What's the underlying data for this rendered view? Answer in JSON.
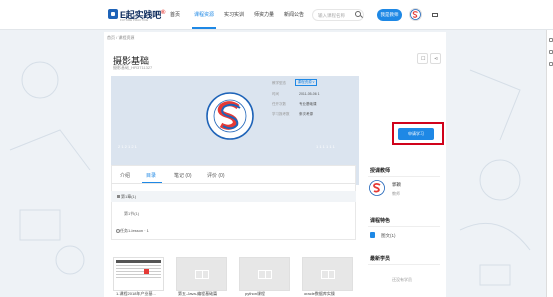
{
  "header": {
    "logo_text": "E起实践吧",
    "logo_sup": "®",
    "logo_sub": "FUTURE PRACTICE",
    "nav": [
      {
        "label": "首页"
      },
      {
        "label": "课程资源"
      },
      {
        "label": "实习实训"
      },
      {
        "label": "师资力量"
      },
      {
        "label": "新闻公告"
      }
    ],
    "search_placeholder": "输入课程名称",
    "teacher_button": "我是教师"
  },
  "breadcrumb": "首页 / 课程资源",
  "course": {
    "title": "摄影基础",
    "code": "摄影基础_HR3711327",
    "cover_caption_left": "2 1 2 1 2 1",
    "cover_caption_right": "1 1 1 1 1 1",
    "info": [
      {
        "label": "教学型态",
        "value": "课程资源 v"
      },
      {
        "label": "时间",
        "value": "2011-05-06 1"
      },
      {
        "label": "任开次数",
        "value": "专业基础课"
      },
      {
        "label": "学习报考数",
        "value": "条次考源"
      }
    ],
    "join_button": "申请学习"
  },
  "tabs": [
    {
      "label": "介绍"
    },
    {
      "label": "目录"
    },
    {
      "label": "笔记 (0)"
    },
    {
      "label": "评价 (0)"
    }
  ],
  "catalog": {
    "chapter": "第1章(1)",
    "section": "第1节(1)",
    "task": "任务1-lesson · 1"
  },
  "sidebar": {
    "teacher_title": "授课教师",
    "teacher_name": "郭颖",
    "teacher_role": "教师",
    "feature_title": "课程特色",
    "feature_item": "图文(1)",
    "latest_title": "最新学员",
    "latest_empty": "还没有学员"
  },
  "cards": [
    {
      "caption": "1-课程2018年产业基..."
    },
    {
      "caption": "第五-Java-编程基础篇"
    },
    {
      "caption": "python课程"
    },
    {
      "caption": "oracle数据库实操"
    }
  ]
}
